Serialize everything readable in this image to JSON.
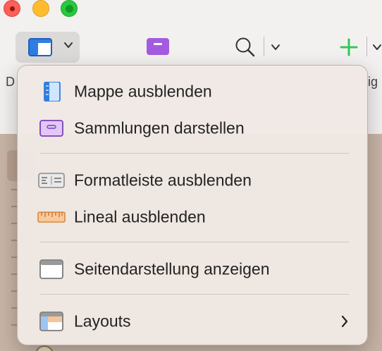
{
  "window": {
    "controls": [
      "close",
      "minimize",
      "zoom"
    ]
  },
  "toolbar": {
    "view_button_icon": "sidebar-panel-icon",
    "collection_icon": "collection-icon",
    "search_icon": "magnifier-icon",
    "add_icon": "plus-icon",
    "left_partial_label": "D",
    "right_partial_label": "ig",
    "accent_green": "#34c759",
    "accent_purple": "#a35ce0"
  },
  "menu": {
    "items": [
      {
        "label": "Mappe ausblenden",
        "icon": "binder-icon"
      },
      {
        "label": "Sammlungen darstellen",
        "icon": "collection-icon"
      },
      {
        "label": "Formatleiste ausblenden",
        "icon": "format-bar-icon"
      },
      {
        "label": "Lineal ausblenden",
        "icon": "ruler-icon"
      },
      {
        "label": "Seitendarstellung anzeigen",
        "icon": "page-view-icon"
      },
      {
        "label": "Layouts",
        "icon": "layouts-icon",
        "submenu": true
      }
    ]
  }
}
